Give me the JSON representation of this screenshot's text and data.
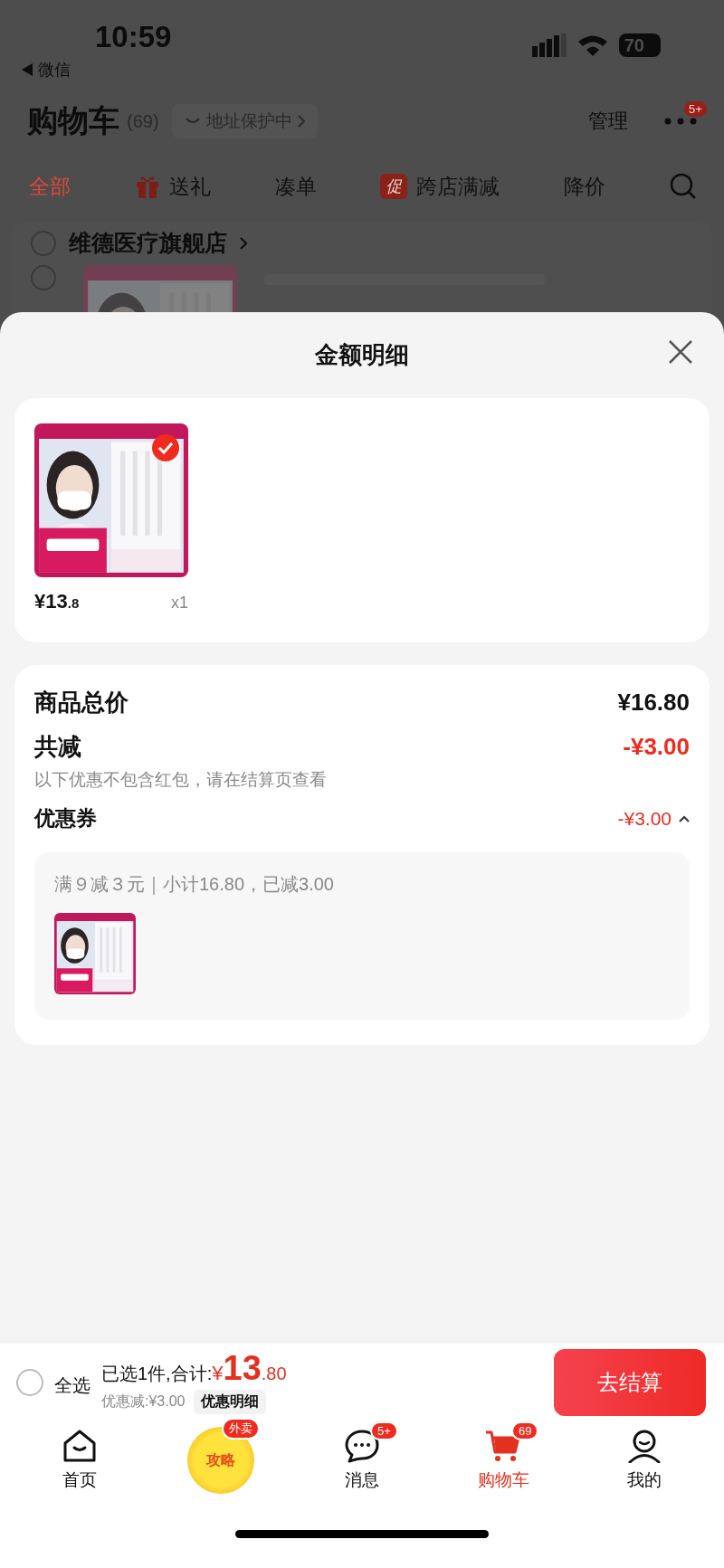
{
  "status_bar": {
    "time": "10:59",
    "back_label": "微信",
    "battery": "70"
  },
  "header": {
    "title": "购物车",
    "count": "(69)",
    "address_label": "地址保护中",
    "manage": "管理",
    "more_badge": "5+"
  },
  "tabs": [
    {
      "label": "全部",
      "kind": "plain",
      "selected": true
    },
    {
      "label": "送礼",
      "kind": "gift",
      "selected": false
    },
    {
      "label": "凑单",
      "kind": "plain",
      "selected": false
    },
    {
      "label": "跨店满减",
      "kind": "promo",
      "badge": "促",
      "selected": false
    },
    {
      "label": "降价",
      "kind": "plain",
      "selected": false
    }
  ],
  "store": {
    "name": "维德医疗旗舰店",
    "checked": false,
    "item_checked": false
  },
  "sheet": {
    "title": "金额明细",
    "items": [
      {
        "checked": true,
        "price_integer": "¥13",
        "price_decimal": ".8",
        "quantity": "x1"
      }
    ],
    "summary": [
      {
        "kind": "total",
        "label": "商品总价",
        "value": "¥16.80"
      },
      {
        "kind": "discount",
        "label": "共减",
        "value": "-¥3.00",
        "note": "以下优惠不包含红包，请在结算页查看"
      },
      {
        "kind": "coupon",
        "label": "优惠券",
        "value": "-¥3.00",
        "expanded": true
      }
    ],
    "coupon_detail": {
      "text": "满９减３元｜小计16.80，已减3.00"
    }
  },
  "checkout": {
    "select_all": {
      "label": "全选",
      "checked": false
    },
    "summary_label": "已选1件,合计:",
    "currency": "¥",
    "amount_integer": "13",
    "amount_decimal": ".80",
    "discount": "优惠减:¥3.00",
    "detail_button": "优惠明细",
    "button": "去结算"
  },
  "nav": [
    {
      "kind": "home",
      "label": "首页",
      "selected": false
    },
    {
      "kind": "promo",
      "icon_text": "攻略",
      "badge": "外卖",
      "selected": false
    },
    {
      "kind": "message",
      "label": "消息",
      "badge": "5+",
      "selected": false
    },
    {
      "kind": "cart",
      "label": "购物车",
      "badge": "69",
      "selected": true
    },
    {
      "kind": "profile",
      "label": "我的",
      "selected": false
    }
  ]
}
